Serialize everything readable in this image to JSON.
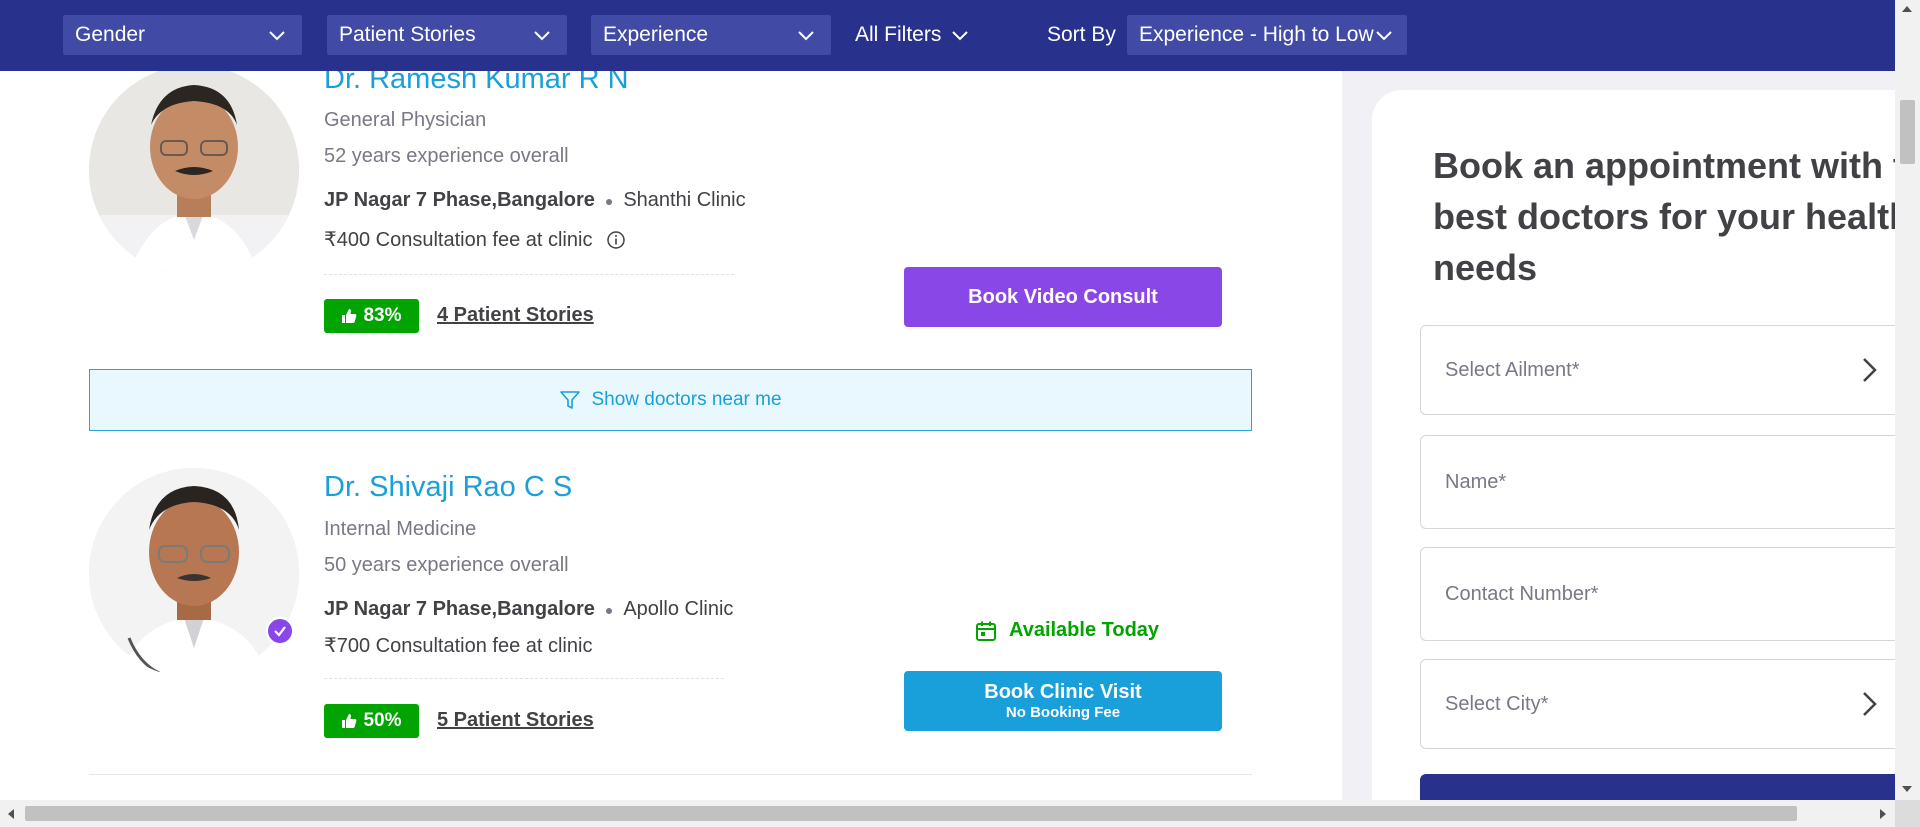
{
  "filters": {
    "gender": "Gender",
    "patient_stories": "Patient Stories",
    "experience": "Experience",
    "all_filters": "All Filters",
    "sort_by_label": "Sort By",
    "sort_by_value": "Experience - High to Low"
  },
  "doctors": [
    {
      "name": "Dr. Ramesh Kumar R N",
      "specialty": "General Physician",
      "experience": "52 years experience overall",
      "locality": "JP Nagar 7 Phase,Bangalore",
      "clinic": "Shanthi Clinic",
      "fee": "₹400 Consultation fee at clinic",
      "rating": "83%",
      "stories": "4 Patient Stories",
      "button": "Book Video Consult"
    },
    {
      "name": "Dr. Shivaji Rao C S",
      "specialty": "Internal Medicine",
      "experience": "50 years experience overall",
      "locality": "JP Nagar 7 Phase,Bangalore",
      "clinic": "Apollo Clinic",
      "fee": "₹700 Consultation fee at clinic",
      "rating": "50%",
      "stories": "5 Patient Stories",
      "availability": "Available Today",
      "button": "Book Clinic Visit",
      "button_sub": "No Booking Fee"
    }
  ],
  "near_me": "Show doctors near me",
  "booking_panel": {
    "title_line1": "Book an appointment with the",
    "title_line2": "best doctors for your health",
    "title_line3": "needs",
    "fields": [
      "Select Ailment*",
      "Name*",
      "Contact Number*",
      "Select City*"
    ]
  },
  "colors": {
    "nav": "#28328c",
    "dropdown": "#414ba5",
    "doctor_name": "#199fd9",
    "video_button": "#8a47e8",
    "clinic_button": "#199fd9",
    "rating_badge": "#01a400"
  }
}
